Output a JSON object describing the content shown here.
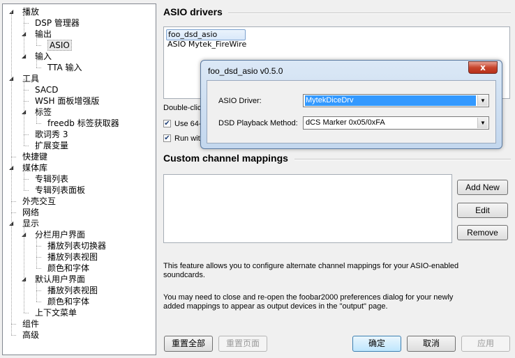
{
  "tree": [
    {
      "label": "播放",
      "level": 0,
      "expander": "◢"
    },
    {
      "label": "DSP 管理器",
      "level": 1
    },
    {
      "label": "输出",
      "level": 1,
      "expander": "◢"
    },
    {
      "label": "ASIO",
      "level": 2,
      "selected": true
    },
    {
      "label": "输入",
      "level": 1,
      "expander": "◢"
    },
    {
      "label": "TTA 输入",
      "level": 2
    },
    {
      "label": "工具",
      "level": 0,
      "expander": "◢"
    },
    {
      "label": "SACD",
      "level": 1
    },
    {
      "label": "WSH 面板增强版",
      "level": 1
    },
    {
      "label": "标签",
      "level": 1,
      "expander": "◢"
    },
    {
      "label": "freedb 标签获取器",
      "level": 2
    },
    {
      "label": "歌词秀 3",
      "level": 1
    },
    {
      "label": "扩展变量",
      "level": 1
    },
    {
      "label": "快捷键",
      "level": 0
    },
    {
      "label": "媒体库",
      "level": 0,
      "expander": "◢"
    },
    {
      "label": "专辑列表",
      "level": 1
    },
    {
      "label": "专辑列表面板",
      "level": 1
    },
    {
      "label": "外壳交互",
      "level": 0
    },
    {
      "label": "网络",
      "level": 0
    },
    {
      "label": "显示",
      "level": 0,
      "expander": "◢"
    },
    {
      "label": "分栏用户界面",
      "level": 1,
      "expander": "◢"
    },
    {
      "label": "播放列表切换器",
      "level": 2
    },
    {
      "label": "播放列表视图",
      "level": 2
    },
    {
      "label": "颜色和字体",
      "level": 2
    },
    {
      "label": "默认用户界面",
      "level": 1,
      "expander": "◢"
    },
    {
      "label": "播放列表视图",
      "level": 2
    },
    {
      "label": "颜色和字体",
      "level": 2
    },
    {
      "label": "上下文菜单",
      "level": 1
    },
    {
      "label": "组件",
      "level": 0
    },
    {
      "label": "高级",
      "level": 0
    }
  ],
  "asio": {
    "title": "ASIO drivers",
    "drivers": [
      "foo_dsd_asio",
      "ASIO Mytek_FireWire"
    ],
    "hint": "Double-click",
    "opt1": "Use 64-",
    "opt2": "Run with"
  },
  "mappings": {
    "title": "Custom channel mappings",
    "add": "Add New",
    "edit": "Edit",
    "remove": "Remove",
    "info1": "This feature allows you to configure alternate channel mappings for your ASIO-enabled",
    "info1b": "soundcards.",
    "info2": "You may need to close and re-open the foobar2000 preferences dialog for your newly",
    "info2b": "added mappings to appear as output devices in the \"output\" page."
  },
  "dialog": {
    "title": "foo_dsd_asio v0.5.0",
    "close": "x",
    "driver_label": "ASIO Driver:",
    "driver_value": "MytekDiceDrv",
    "playback_label": "DSD Playback Method:",
    "playback_value": "dCS Marker 0x05/0xFA"
  },
  "footer": {
    "reset_all": "重置全部",
    "reset_page": "重置页面",
    "ok": "确定",
    "cancel": "取消",
    "apply": "应用"
  }
}
